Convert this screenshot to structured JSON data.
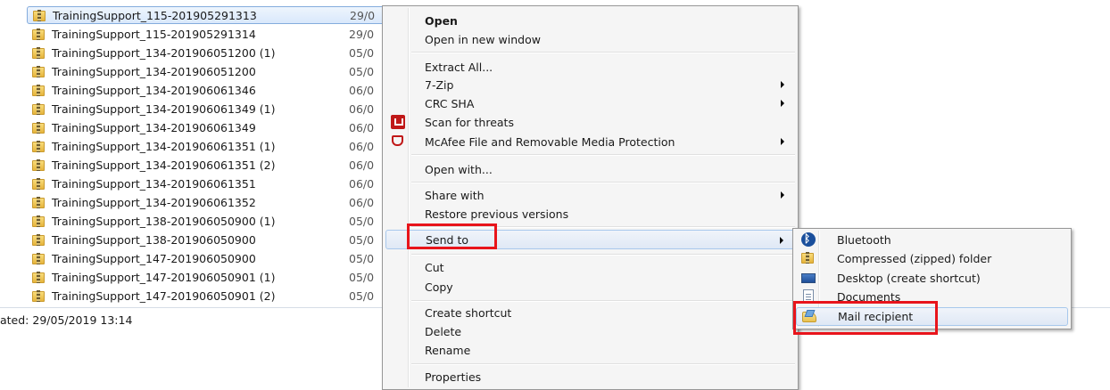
{
  "files": [
    {
      "name": "TrainingSupport_115-201905291313",
      "date": "29/0"
    },
    {
      "name": "TrainingSupport_115-201905291314",
      "date": "29/0"
    },
    {
      "name": "TrainingSupport_134-201906051200 (1)",
      "date": "05/0"
    },
    {
      "name": "TrainingSupport_134-201906051200",
      "date": "05/0"
    },
    {
      "name": "TrainingSupport_134-201906061346",
      "date": "06/0"
    },
    {
      "name": "TrainingSupport_134-201906061349 (1)",
      "date": "06/0"
    },
    {
      "name": "TrainingSupport_134-201906061349",
      "date": "06/0"
    },
    {
      "name": "TrainingSupport_134-201906061351 (1)",
      "date": "06/0"
    },
    {
      "name": "TrainingSupport_134-201906061351 (2)",
      "date": "06/0"
    },
    {
      "name": "TrainingSupport_134-201906061351",
      "date": "06/0"
    },
    {
      "name": "TrainingSupport_134-201906061352",
      "date": "06/0"
    },
    {
      "name": "TrainingSupport_138-201906050900 (1)",
      "date": "05/0"
    },
    {
      "name": "TrainingSupport_138-201906050900",
      "date": "05/0"
    },
    {
      "name": "TrainingSupport_147-201906050900",
      "date": "05/0"
    },
    {
      "name": "TrainingSupport_147-201906050901 (1)",
      "date": "05/0"
    },
    {
      "name": "TrainingSupport_147-201906050901 (2)",
      "date": "05/0"
    }
  ],
  "status": {
    "text": "ated: 29/05/2019 13:14"
  },
  "menu": {
    "open": "Open",
    "open_new_window": "Open in new window",
    "extract_all": "Extract All...",
    "seven_zip": "7-Zip",
    "crc_sha": "CRC SHA",
    "scan_threats": "Scan for threats",
    "mcafee_protection": "McAfee File and Removable Media Protection",
    "open_with": "Open with...",
    "share_with": "Share with",
    "restore_versions": "Restore previous versions",
    "send_to": "Send to",
    "cut": "Cut",
    "copy": "Copy",
    "create_shortcut": "Create shortcut",
    "delete": "Delete",
    "rename": "Rename",
    "properties": "Properties"
  },
  "send_to_menu": {
    "bluetooth": "Bluetooth",
    "compressed": "Compressed (zipped) folder",
    "desktop": "Desktop (create shortcut)",
    "documents": "Documents",
    "mail": "Mail recipient"
  },
  "colors": {
    "highlight": "#e8141b",
    "mcafee": "#c01818",
    "selection_border": "#84acdd"
  },
  "icons": {
    "file": "zip-folder-icon",
    "scan": "mcafee-shield-icon",
    "mcafee": "mcafee-outline-icon",
    "bluetooth": "bluetooth-icon",
    "compressed": "zip-folder-icon",
    "desktop": "desktop-icon",
    "documents": "document-icon",
    "mail": "mail-recipient-icon"
  }
}
